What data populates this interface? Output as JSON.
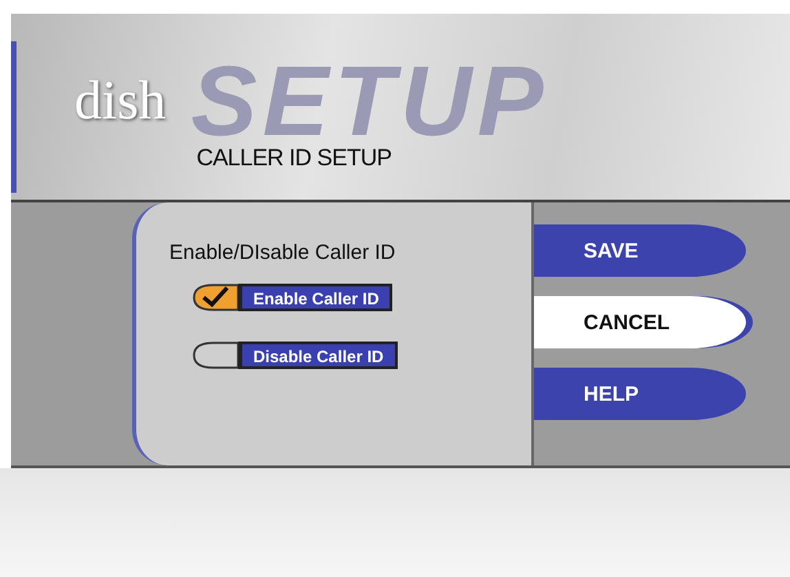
{
  "header": {
    "logo": "dish",
    "banner": "SETUP",
    "title": "CALLER ID SETUP"
  },
  "panel": {
    "heading": "Enable/DIsable Caller ID",
    "options": [
      {
        "label": "Enable Caller ID",
        "checked": true
      },
      {
        "label": "Disable Caller ID",
        "checked": false
      }
    ]
  },
  "buttons": [
    {
      "label": "SAVE",
      "selected": false
    },
    {
      "label": "CANCEL",
      "selected": true
    },
    {
      "label": "HELP",
      "selected": false
    }
  ]
}
